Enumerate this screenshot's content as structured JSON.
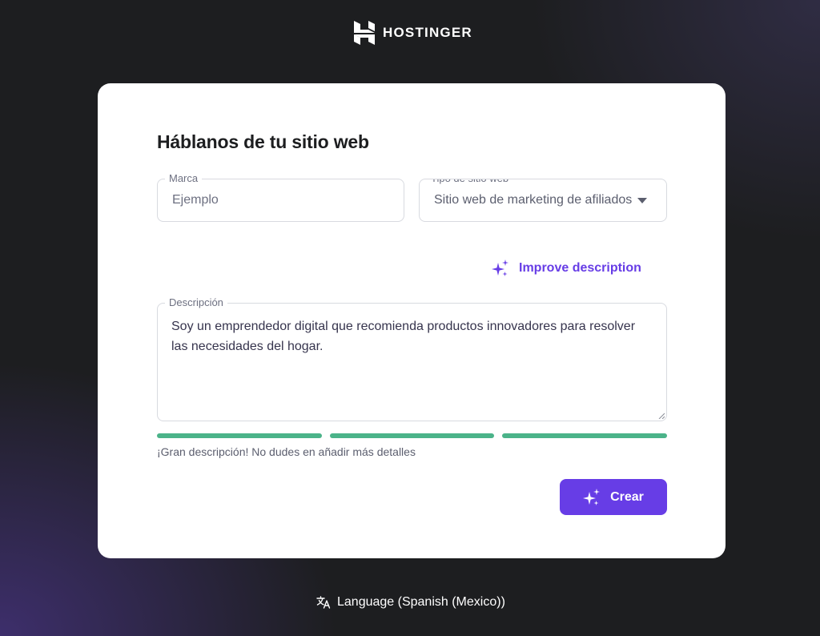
{
  "header": {
    "brand_name": "HOSTINGER",
    "logo_icon": "hostinger-logo-icon"
  },
  "form": {
    "title": "Háblanos de tu sitio web",
    "brand_field": {
      "label": "Marca",
      "placeholder": "Ejemplo"
    },
    "site_type_field": {
      "label": "Tipo de sitio web",
      "selected": "Sitio web de marketing de afiliados"
    },
    "improve_description": {
      "label": "Improve description",
      "icon": "sparkles-icon"
    },
    "description_field": {
      "label": "Descripción",
      "value": "Soy un emprendedor digital que recomienda productos innovadores para resolver las necesidades del hogar."
    },
    "strength": {
      "segments": 3,
      "filled": 3,
      "message": "¡Gran descripción! No dudes en añadir más detalles"
    },
    "create_button": {
      "label": "Crear",
      "icon": "sparkles-icon"
    }
  },
  "footer": {
    "language_label": "Language (Spanish (Mexico))",
    "icon": "translate-icon"
  },
  "colors": {
    "accent": "#673de6",
    "success": "#4bb389",
    "background": "#1d1e20",
    "card": "#ffffff"
  }
}
